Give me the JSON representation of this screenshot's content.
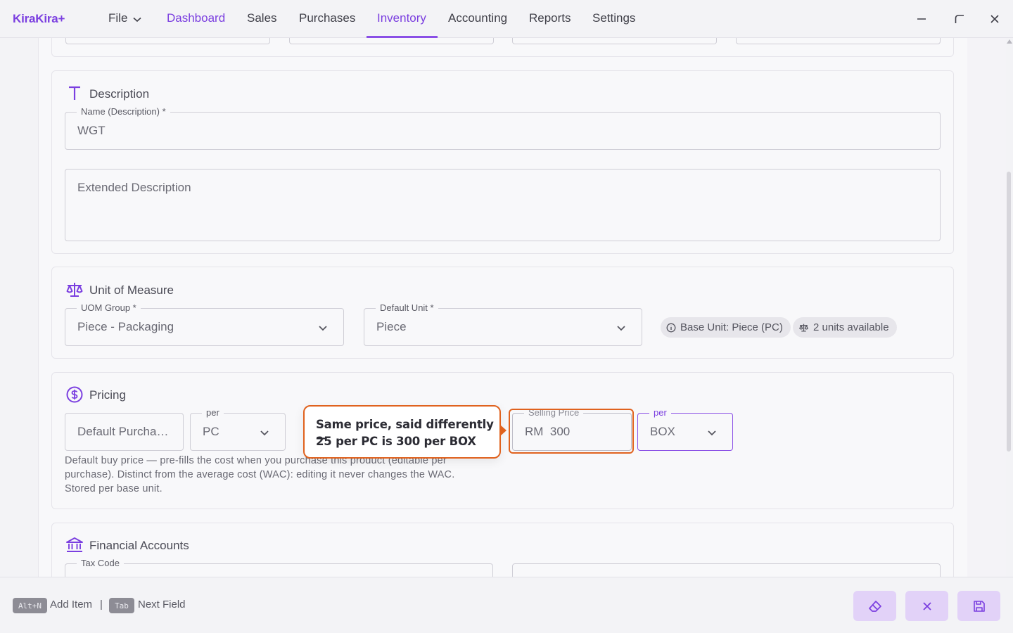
{
  "app": {
    "logo": "KiraKira+"
  },
  "menu": {
    "file": "File",
    "items": [
      "Dashboard",
      "Sales",
      "Purchases",
      "Inventory",
      "Accounting",
      "Reports",
      "Settings"
    ],
    "active": "Inventory"
  },
  "description": {
    "title": "Description",
    "name_label": "Name (Description) *",
    "name_value": "WGT",
    "extended_placeholder": "Extended Description"
  },
  "uom": {
    "title": "Unit of Measure",
    "group_label": "UOM Group *",
    "group_value": "Piece - Packaging",
    "default_unit_label": "Default Unit *",
    "default_unit_value": "Piece",
    "base_unit_chip": "Base Unit: Piece (PC)",
    "units_chip": "2 units available"
  },
  "pricing": {
    "title": "Pricing",
    "purchase_placeholder": "Default Purcha…",
    "per_label": "per",
    "purchase_unit": "PC",
    "selling_label": "Selling Price",
    "selling_value": "RM  300",
    "selling_per_label": "per",
    "selling_unit": "BOX",
    "helper": "Default buy price — pre-fills the cost when you purchase this product (editable per purchase). Distinct from the average cost (WAC): editing it never changes the WAC. Stored per base unit."
  },
  "tooltip": {
    "line1": "Same price, said differently —",
    "line2": "25 per PC is 300 per BOX"
  },
  "financial": {
    "title": "Financial Accounts",
    "tax_code_label": "Tax Code"
  },
  "bottom": {
    "shortcut1_key": "Alt+N",
    "shortcut1_label": "Add Item",
    "separator": "|",
    "shortcut2_key": "Tab",
    "shortcut2_label": "Next Field"
  },
  "colors": {
    "accent": "#7b3fe0",
    "highlight": "#e0621e",
    "button_bg": "#e2d2f8"
  }
}
